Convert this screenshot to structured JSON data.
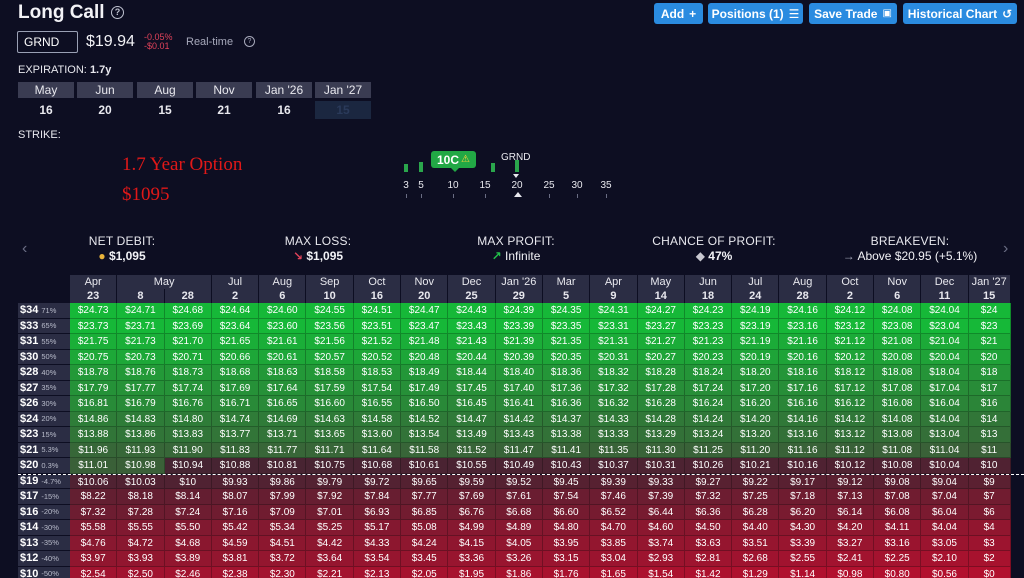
{
  "header": {
    "title": "Long Call",
    "buttons": [
      {
        "label": "Add",
        "icon": "+"
      },
      {
        "label": "Positions (1)",
        "icon": "☰"
      },
      {
        "label": "Save Trade",
        "icon": "💾"
      },
      {
        "label": "Historical Chart",
        "icon": "↺"
      }
    ]
  },
  "quote": {
    "ticker": "GRND",
    "price": "$19.94",
    "change_pct": "-0.05%",
    "change_abs": "-$0.01",
    "realtime": "Real-time"
  },
  "expiration": {
    "label": "EXPIRATION:",
    "value": "1.7y",
    "months": [
      "May",
      "Jun",
      "Aug",
      "Nov",
      "Jan '26",
      "Jan '27"
    ],
    "days": [
      "16",
      "20",
      "15",
      "21",
      "16",
      "15"
    ]
  },
  "strike": {
    "label": "STRIKE:",
    "selected": "10C",
    "underlying": "GRND",
    "ticks": [
      "3",
      "5",
      "10",
      "15",
      "20",
      "25",
      "30",
      "35"
    ]
  },
  "annotations": [
    "1.7 Year Option",
    "$1095"
  ],
  "metrics": [
    {
      "label": "NET DEBIT:",
      "value": "$1,095",
      "icon": "💰"
    },
    {
      "label": "MAX LOSS:",
      "value": "$1,095",
      "icon": "↘"
    },
    {
      "label": "MAX PROFIT:",
      "value": "Infinite",
      "icon": "↗"
    },
    {
      "label": "CHANCE OF PROFIT:",
      "value": "47%",
      "icon": "🎲"
    },
    {
      "label": "BREAKEVEN:",
      "value": "Above $20.95 (+5.1%)",
      "icon": "→"
    }
  ],
  "table": {
    "month_row": [
      "Apr",
      "May",
      "",
      "Jul",
      "Aug",
      "Sep",
      "Oct",
      "Nov",
      "Dec",
      "Jan '26",
      "Mar",
      "Apr",
      "May",
      "Jun",
      "Jul",
      "Aug",
      "Oct",
      "Nov",
      "Dec",
      "Jan '27"
    ],
    "day_row": [
      "23",
      "8",
      "28",
      "2",
      "6",
      "10",
      "16",
      "20",
      "25",
      "29",
      "5",
      "9",
      "14",
      "18",
      "24",
      "28",
      "2",
      "6",
      "11",
      "15"
    ],
    "rows": [
      {
        "price": "$34",
        "pct": "71%",
        "values": [
          "$24.73",
          "$24.71",
          "$24.68",
          "$24.64",
          "$24.60",
          "$24.55",
          "$24.51",
          "$24.47",
          "$24.43",
          "$24.39",
          "$24.35",
          "$24.31",
          "$24.27",
          "$24.23",
          "$24.19",
          "$24.16",
          "$24.12",
          "$24.08",
          "$24.04",
          "$24"
        ]
      },
      {
        "price": "$33",
        "pct": "65%",
        "values": [
          "$23.73",
          "$23.71",
          "$23.69",
          "$23.64",
          "$23.60",
          "$23.56",
          "$23.51",
          "$23.47",
          "$23.43",
          "$23.39",
          "$23.35",
          "$23.31",
          "$23.27",
          "$23.23",
          "$23.19",
          "$23.16",
          "$23.12",
          "$23.08",
          "$23.04",
          "$23"
        ]
      },
      {
        "price": "$31",
        "pct": "55%",
        "values": [
          "$21.75",
          "$21.73",
          "$21.70",
          "$21.65",
          "$21.61",
          "$21.56",
          "$21.52",
          "$21.48",
          "$21.43",
          "$21.39",
          "$21.35",
          "$21.31",
          "$21.27",
          "$21.23",
          "$21.19",
          "$21.16",
          "$21.12",
          "$21.08",
          "$21.04",
          "$21"
        ]
      },
      {
        "price": "$30",
        "pct": "50%",
        "values": [
          "$20.75",
          "$20.73",
          "$20.71",
          "$20.66",
          "$20.61",
          "$20.57",
          "$20.52",
          "$20.48",
          "$20.44",
          "$20.39",
          "$20.35",
          "$20.31",
          "$20.27",
          "$20.23",
          "$20.19",
          "$20.16",
          "$20.12",
          "$20.08",
          "$20.04",
          "$20"
        ]
      },
      {
        "price": "$28",
        "pct": "40%",
        "values": [
          "$18.78",
          "$18.76",
          "$18.73",
          "$18.68",
          "$18.63",
          "$18.58",
          "$18.53",
          "$18.49",
          "$18.44",
          "$18.40",
          "$18.36",
          "$18.32",
          "$18.28",
          "$18.24",
          "$18.20",
          "$18.16",
          "$18.12",
          "$18.08",
          "$18.04",
          "$18"
        ]
      },
      {
        "price": "$27",
        "pct": "35%",
        "values": [
          "$17.79",
          "$17.77",
          "$17.74",
          "$17.69",
          "$17.64",
          "$17.59",
          "$17.54",
          "$17.49",
          "$17.45",
          "$17.40",
          "$17.36",
          "$17.32",
          "$17.28",
          "$17.24",
          "$17.20",
          "$17.16",
          "$17.12",
          "$17.08",
          "$17.04",
          "$17"
        ]
      },
      {
        "price": "$26",
        "pct": "30%",
        "values": [
          "$16.81",
          "$16.79",
          "$16.76",
          "$16.71",
          "$16.65",
          "$16.60",
          "$16.55",
          "$16.50",
          "$16.45",
          "$16.41",
          "$16.36",
          "$16.32",
          "$16.28",
          "$16.24",
          "$16.20",
          "$16.16",
          "$16.12",
          "$16.08",
          "$16.04",
          "$16"
        ]
      },
      {
        "price": "$24",
        "pct": "20%",
        "values": [
          "$14.86",
          "$14.83",
          "$14.80",
          "$14.74",
          "$14.69",
          "$14.63",
          "$14.58",
          "$14.52",
          "$14.47",
          "$14.42",
          "$14.37",
          "$14.33",
          "$14.28",
          "$14.24",
          "$14.20",
          "$14.16",
          "$14.12",
          "$14.08",
          "$14.04",
          "$14"
        ]
      },
      {
        "price": "$23",
        "pct": "15%",
        "values": [
          "$13.88",
          "$13.86",
          "$13.83",
          "$13.77",
          "$13.71",
          "$13.65",
          "$13.60",
          "$13.54",
          "$13.49",
          "$13.43",
          "$13.38",
          "$13.33",
          "$13.29",
          "$13.24",
          "$13.20",
          "$13.16",
          "$13.12",
          "$13.08",
          "$13.04",
          "$13"
        ]
      },
      {
        "price": "$21",
        "pct": "5.3%",
        "values": [
          "$11.96",
          "$11.93",
          "$11.90",
          "$11.83",
          "$11.77",
          "$11.71",
          "$11.64",
          "$11.58",
          "$11.52",
          "$11.47",
          "$11.41",
          "$11.35",
          "$11.30",
          "$11.25",
          "$11.20",
          "$11.16",
          "$11.12",
          "$11.08",
          "$11.04",
          "$11"
        ]
      },
      {
        "price": "$20",
        "pct": "0.3%",
        "values": [
          "$11.01",
          "$10.98",
          "$10.94",
          "$10.88",
          "$10.81",
          "$10.75",
          "$10.68",
          "$10.61",
          "$10.55",
          "$10.49",
          "$10.43",
          "$10.37",
          "$10.31",
          "$10.26",
          "$10.21",
          "$10.16",
          "$10.12",
          "$10.08",
          "$10.04",
          "$10"
        ]
      },
      {
        "price": "$19",
        "pct": "-4.7%",
        "values": [
          "$10.06",
          "$10.03",
          "$10",
          "$9.93",
          "$9.86",
          "$9.79",
          "$9.72",
          "$9.65",
          "$9.59",
          "$9.52",
          "$9.45",
          "$9.39",
          "$9.33",
          "$9.27",
          "$9.22",
          "$9.17",
          "$9.12",
          "$9.08",
          "$9.04",
          "$9"
        ]
      },
      {
        "price": "$17",
        "pct": "-15%",
        "values": [
          "$8.22",
          "$8.18",
          "$8.14",
          "$8.07",
          "$7.99",
          "$7.92",
          "$7.84",
          "$7.77",
          "$7.69",
          "$7.61",
          "$7.54",
          "$7.46",
          "$7.39",
          "$7.32",
          "$7.25",
          "$7.18",
          "$7.13",
          "$7.08",
          "$7.04",
          "$7"
        ]
      },
      {
        "price": "$16",
        "pct": "-20%",
        "values": [
          "$7.32",
          "$7.28",
          "$7.24",
          "$7.16",
          "$7.09",
          "$7.01",
          "$6.93",
          "$6.85",
          "$6.76",
          "$6.68",
          "$6.60",
          "$6.52",
          "$6.44",
          "$6.36",
          "$6.28",
          "$6.20",
          "$6.14",
          "$6.08",
          "$6.04",
          "$6"
        ]
      },
      {
        "price": "$14",
        "pct": "-30%",
        "values": [
          "$5.58",
          "$5.55",
          "$5.50",
          "$5.42",
          "$5.34",
          "$5.25",
          "$5.17",
          "$5.08",
          "$4.99",
          "$4.89",
          "$4.80",
          "$4.70",
          "$4.60",
          "$4.50",
          "$4.40",
          "$4.30",
          "$4.20",
          "$4.11",
          "$4.04",
          "$4"
        ]
      },
      {
        "price": "$13",
        "pct": "-35%",
        "values": [
          "$4.76",
          "$4.72",
          "$4.68",
          "$4.59",
          "$4.51",
          "$4.42",
          "$4.33",
          "$4.24",
          "$4.15",
          "$4.05",
          "$3.95",
          "$3.85",
          "$3.74",
          "$3.63",
          "$3.51",
          "$3.39",
          "$3.27",
          "$3.16",
          "$3.05",
          "$3"
        ]
      },
      {
        "price": "$12",
        "pct": "-40%",
        "values": [
          "$3.97",
          "$3.93",
          "$3.89",
          "$3.81",
          "$3.72",
          "$3.64",
          "$3.54",
          "$3.45",
          "$3.36",
          "$3.26",
          "$3.15",
          "$3.04",
          "$2.93",
          "$2.81",
          "$2.68",
          "$2.55",
          "$2.41",
          "$2.25",
          "$2.10",
          "$2"
        ]
      },
      {
        "price": "$10",
        "pct": "-50%",
        "values": [
          "$2.54",
          "$2.50",
          "$2.46",
          "$2.38",
          "$2.30",
          "$2.21",
          "$2.13",
          "$2.05",
          "$1.95",
          "$1.86",
          "$1.76",
          "$1.65",
          "$1.54",
          "$1.42",
          "$1.29",
          "$1.14",
          "$0.98",
          "$0.80",
          "$0.56",
          "$0"
        ]
      }
    ]
  },
  "colors": {
    "profit_high": "#16b838",
    "profit_low": "#3f6b3c",
    "loss_low": "#4a2332",
    "loss_high": "#b01030",
    "accent": "#2a8be0"
  }
}
